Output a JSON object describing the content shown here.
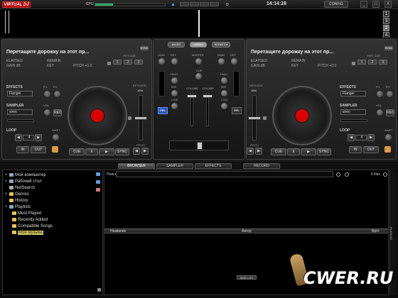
{
  "app": {
    "logo": "VIRTUAL DJ",
    "cpu_label": "CPU",
    "cpu_percent": 25,
    "clock": "14:14:28",
    "config": "CONFIG",
    "win_min": "_",
    "win_max": "□",
    "win_close": "X",
    "deck_numbers": [
      "1",
      "3",
      "2",
      "4"
    ]
  },
  "left_deck": {
    "title": "Перетащите дорожку на этот пр...",
    "badge": "SYNC",
    "elapsed": "ELAPSED",
    "gain": "GAIN dB",
    "remain": "REMAIN",
    "key": "KEY",
    "pitch": "PITCH +0.0",
    "hot_cue_label": "HOT CUE",
    "hot_cues": [
      "1",
      "2",
      "3"
    ],
    "effects_label": "EFFECTS",
    "effect_value": "Flanger",
    "p1": "P.1",
    "p2": "P.2",
    "sampler_label": "SAMPLER",
    "sampler_value": "siren",
    "vol": "VOL",
    "rec": "REC",
    "loop_label": "LOOP",
    "loop_value": "4",
    "shift": "SHIFT",
    "in": "IN",
    "out": "OUT",
    "keylock": "KEYLOCK",
    "keylock_pct": "10%",
    "pitch_label": "PITCH",
    "cue": "CUE",
    "pause": "II",
    "play": "▶",
    "sync": "SYNC",
    "pitch_position": 0.5
  },
  "right_deck": {
    "title": "Перетащите дорожку на этот пр...",
    "badge": "SYNC",
    "elapsed": "ELAPSED",
    "gain": "GAIN dB",
    "remain": "REMAIN",
    "key": "KEY",
    "pitch": "PITCH +0.0",
    "hot_cue_label": "HOT CUE",
    "hot_cues": [
      "1",
      "2",
      "3"
    ],
    "effects_label": "EFFECTS",
    "effect_value": "Flanger",
    "p1": "P.1",
    "p2": "P.2",
    "sampler_label": "SAMPLER",
    "sampler_value": "siren",
    "vol": "VOL",
    "rec": "REC",
    "loop_label": "LOOP",
    "loop_value": "4",
    "shift": "SHIFT",
    "in": "IN",
    "out": "OUT",
    "keylock": "KEYLOCK",
    "keylock_pct": "10%",
    "pitch_label": "PITCH",
    "cue": "CUE",
    "pause": "II",
    "play": "▶",
    "sync": "SYNC",
    "pitch_position": 0.5
  },
  "mixer": {
    "tabs": [
      "MIXER",
      "VIDEO",
      "SCRATCH"
    ],
    "gain": "GAIN",
    "key": "KEY",
    "master": "MASTER",
    "cue": "CUE",
    "high": "HIGH",
    "mid": "MID",
    "low": "LOW",
    "volume": "VOLUME",
    "pfl": "PFL"
  },
  "browser": {
    "tabs": [
      "BROWSER",
      "SAMPLER",
      "EFFECTS",
      "RECORD"
    ],
    "active_tab": "BROWSER",
    "tree": [
      {
        "label": "Мой компьютер",
        "icon": "computer-icon",
        "twisty": "+"
      },
      {
        "label": "Рабочий стол",
        "icon": "desktop-folder-icon",
        "twisty": "+"
      },
      {
        "label": "NetSearch",
        "icon": "netsearch-icon",
        "twisty": ""
      },
      {
        "label": "Genres",
        "icon": "genres-icon",
        "twisty": "+"
      },
      {
        "label": "History",
        "icon": "history-icon",
        "twisty": ""
      },
      {
        "label": "Playlists",
        "icon": "playlists-icon",
        "twisty": "+"
      },
      {
        "label": "Most Played",
        "icon": "folder-icon",
        "twisty": ""
      },
      {
        "label": "Recently Added",
        "icon": "folder-icon",
        "twisty": ""
      },
      {
        "label": "Compatible Songs",
        "icon": "folder-icon",
        "twisty": ""
      },
      {
        "label": "Моя музыка",
        "icon": "music-folder-icon",
        "twisty": "",
        "selected": true
      }
    ],
    "search_label": "Поиск:",
    "search_value": "",
    "files": "0 files",
    "columns": [
      "Название",
      "Автор",
      "Bpm"
    ],
    "side_list": "SIDE LIST",
    "playlist": "PLAYLIST"
  },
  "watermark": "CWER.RU"
}
